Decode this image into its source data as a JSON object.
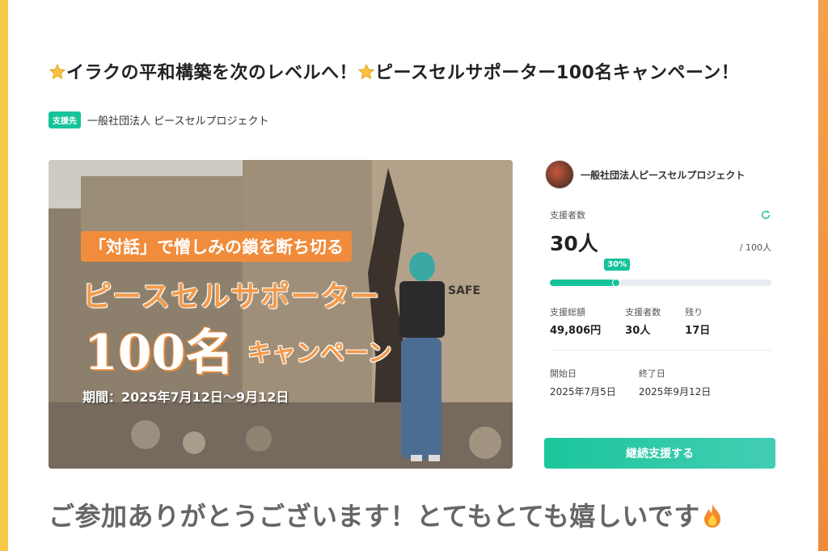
{
  "page": {
    "title": "⭐イラクの平和構築を次のレベルへ！⭐ピースセルサポーター100名キャンペーン！",
    "title_line1": "イラクの平和構築を次のレベルへ！",
    "title_line2": "ピースセルサポーター100名キャンペーン！",
    "badge_label": "支援先",
    "org_name": "一般社団法人 ピースセルプロジェクト"
  },
  "hero": {
    "subtitle": "「対話」で憎しみの鎖を断ち切る",
    "headline": "ピースセルサポーター",
    "big_number": "100名",
    "campaign": "キャンペーン",
    "period": "期間：2025年7月12日〜9月12日",
    "wall_text": "SAFE"
  },
  "sidebar": {
    "org_name": "一般社団法人ピースセルプロジェクト",
    "supporters_label": "支援者数",
    "supporters_count": "30人",
    "goal": "/ 100人",
    "progress_label": "30%",
    "progress_fraction": 0.3,
    "stats": [
      {
        "label": "支援総額",
        "value": "49,806円"
      },
      {
        "label": "支援者数",
        "value": "30人"
      },
      {
        "label": "残り",
        "value": "17日"
      }
    ],
    "dates": [
      {
        "label": "開始日",
        "value": "2025年7月5日"
      },
      {
        "label": "終了日",
        "value": "2025年9月12日"
      }
    ],
    "cta_label": "継続支援する"
  },
  "footer": {
    "thanks_text": "ご参加ありがとうございます！とてもとても嬉しいです"
  },
  "colors": {
    "accent": "#16c39a",
    "hero_orange": "#f08c3c",
    "left_edge": "#f7c948",
    "right_edge": "#ef8a3a"
  },
  "icons": [
    "star-icon",
    "refresh-icon",
    "fire-icon"
  ]
}
